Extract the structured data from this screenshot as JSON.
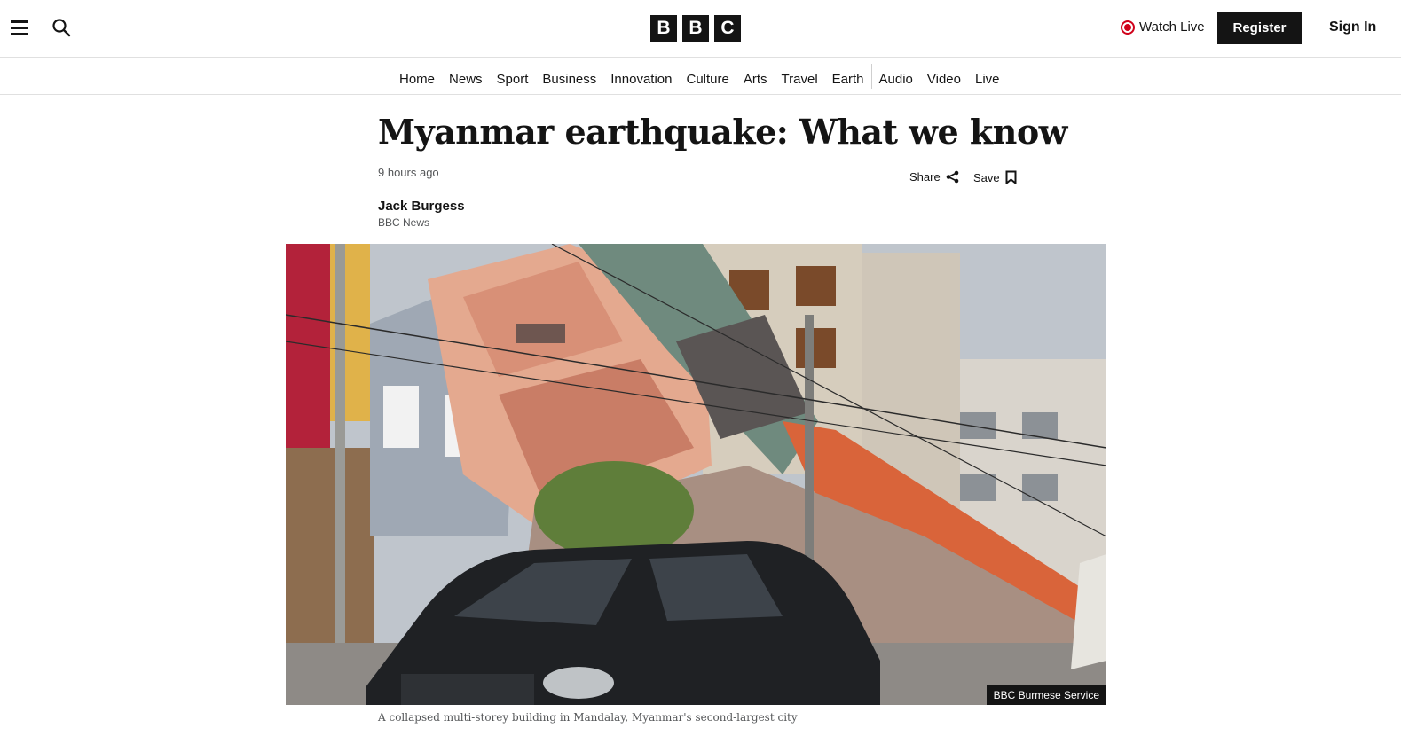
{
  "header": {
    "logo_letters": [
      "B",
      "B",
      "C"
    ],
    "watch_live_label": "Watch Live",
    "register_label": "Register",
    "sign_in_label": "Sign In",
    "icons": {
      "menu": "menu-icon",
      "search": "search-icon",
      "live": "live-indicator-icon"
    }
  },
  "nav": {
    "items": [
      "Home",
      "News",
      "Sport",
      "Business",
      "Innovation",
      "Culture",
      "Arts",
      "Travel",
      "Earth",
      "Audio",
      "Video",
      "Live"
    ]
  },
  "article": {
    "headline": "Myanmar earthquake: What we know",
    "timestamp": "9 hours ago",
    "share_label": "Share",
    "save_label": "Save",
    "author": "Jack Burgess",
    "outlet": "BBC News",
    "image_credit": "BBC Burmese Service",
    "caption": "A collapsed multi-storey building in Mandalay, Myanmar's second-largest city"
  },
  "colors": {
    "live_red": "#d0021b",
    "text": "#141414",
    "meta": "#545658"
  }
}
